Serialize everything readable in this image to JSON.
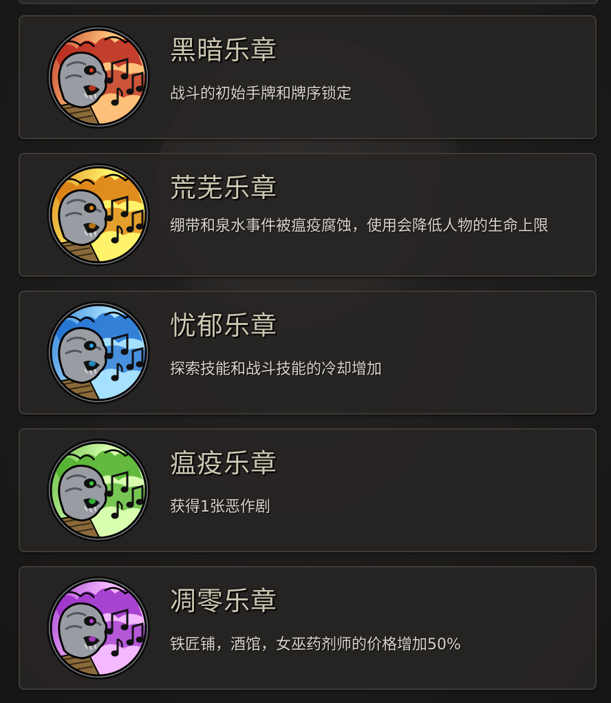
{
  "items": [
    {
      "title": "黑暗乐章",
      "description": "战斗的初始手牌和牌序锁定",
      "icon": "dark-movement-icon",
      "flame_light": "#ffc07a",
      "flame_dark": "#b8281e",
      "eye_color": "#e04020"
    },
    {
      "title": "荒芜乐章",
      "description": "绷带和泉水事件被瘟疫腐蚀，使用会降低人物的生命上限",
      "icon": "barren-movement-icon",
      "flame_light": "#fff36b",
      "flame_dark": "#d97a12",
      "eye_color": "#e08a18"
    },
    {
      "title": "忧郁乐章",
      "description": "探索技能和战斗技能的冷却增加",
      "icon": "melancholy-movement-icon",
      "flame_light": "#a6e0ff",
      "flame_dark": "#1f6fd0",
      "eye_color": "#2aa8e8"
    },
    {
      "title": "瘟疫乐章",
      "description": "获得1张恶作剧",
      "icon": "plague-movement-icon",
      "flame_light": "#d8ffb0",
      "flame_dark": "#4fae2c",
      "eye_color": "#3ccf40"
    },
    {
      "title": "凋零乐章",
      "description": "铁匠铺，酒馆，女巫药剂师的价格增加50%",
      "icon": "withering-movement-icon",
      "flame_light": "#f4b8ff",
      "flame_dark": "#9a2fc8",
      "eye_color": "#c040e0"
    }
  ]
}
